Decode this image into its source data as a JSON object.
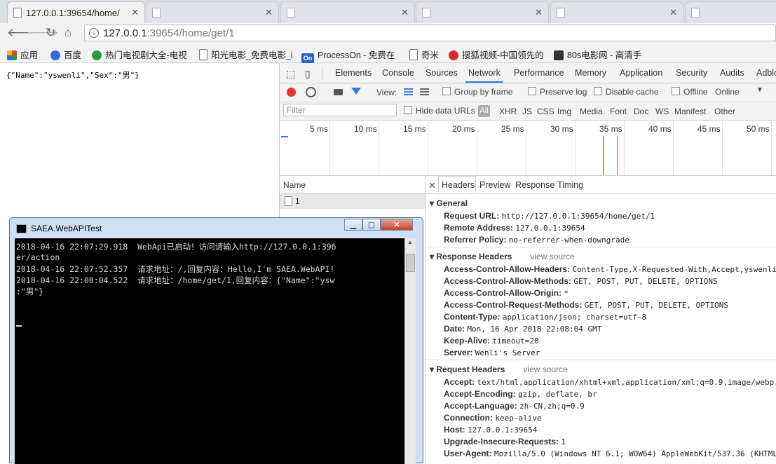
{
  "tabs": [
    {
      "title": "127.0.0.1:39654/home/",
      "state": "active"
    },
    {
      "title": "",
      "state": "inactive"
    },
    {
      "title": "",
      "state": "inactive"
    },
    {
      "title": "",
      "state": "inactive"
    },
    {
      "title": "",
      "state": "inactive"
    },
    {
      "title": "",
      "state": "inactive"
    }
  ],
  "address": {
    "host": "127.0.0.1",
    "path": ":39654/home/get/1"
  },
  "bookmarks": [
    {
      "label": "应用",
      "color": "#e0443a"
    },
    {
      "label": "百度",
      "color": "#3b68d8"
    },
    {
      "label": "热门电视剧大全-电视",
      "color": "#2a9a3c"
    },
    {
      "label": "阳光电影_免费电影_i",
      "color": "#ffffff"
    },
    {
      "label": "ProcessOn - 免费在",
      "color": "#2766c6"
    },
    {
      "label": "奇米",
      "color": "#ffffff"
    },
    {
      "label": "搜狐视频-中国领先的",
      "color": "#d62b2b"
    },
    {
      "label": "80s电影网 - 高清手",
      "color": "#333333"
    }
  ],
  "page_json_text": "{\"Name\":\"yswenli\",\"Sex\":\"男\"}",
  "devtools": {
    "tabs": [
      "Elements",
      "Console",
      "Sources",
      "Network",
      "Performance",
      "Memory",
      "Application",
      "Security",
      "Audits",
      "Adblo"
    ],
    "selected_tab": "Network",
    "controls": {
      "view_label": "View:",
      "group_by_frame": "Group by frame",
      "preserve_log": "Preserve log",
      "disable_cache": "Disable cache",
      "offline": "Offline",
      "throttle": "Online"
    },
    "filter": {
      "placeholder": "Filter",
      "hide_data_urls": "Hide data URLs",
      "all": "All",
      "types": [
        "XHR",
        "JS",
        "CSS",
        "Img",
        "Media",
        "Font",
        "Doc",
        "WS",
        "Manifest",
        "Other"
      ]
    },
    "timeline_ticks": [
      "5 ms",
      "10 ms",
      "15 ms",
      "20 ms",
      "25 ms",
      "30 ms",
      "35 ms",
      "40 ms",
      "45 ms",
      "50 ms"
    ],
    "name_header": "Name",
    "requests": [
      "1"
    ],
    "detail_tabs": [
      "Headers",
      "Preview",
      "Response",
      "Timing"
    ],
    "general": {
      "title": "General",
      "rows": [
        {
          "k": "Request URL:",
          "v": "http://127.0.0.1:39654/home/get/1"
        },
        {
          "k": "Remote Address:",
          "v": "127.0.0.1:39654"
        },
        {
          "k": "Referrer Policy:",
          "v": "no-referrer-when-downgrade"
        }
      ]
    },
    "response_headers": {
      "title": "Response Headers",
      "view_source": "view source",
      "rows": [
        {
          "k": "Access-Control-Allow-Headers:",
          "v": "Content-Type,X-Requested-With,Accept,yswenli"
        },
        {
          "k": "Access-Control-Allow-Methods:",
          "v": "GET, POST, PUT, DELETE, OPTIONS"
        },
        {
          "k": "Access-Control-Allow-Origin:",
          "v": "*"
        },
        {
          "k": "Access-Control-Request-Methods:",
          "v": "GET, POST, PUT, DELETE, OPTIONS"
        },
        {
          "k": "Content-Type:",
          "v": "application/json; charset=utf-8"
        },
        {
          "k": "Date:",
          "v": "Mon, 16 Apr 2018 22:08:04 GMT"
        },
        {
          "k": "Keep-Alive:",
          "v": "timeout=20"
        },
        {
          "k": "Server:",
          "v": "Wenli's Server"
        }
      ]
    },
    "request_headers": {
      "title": "Request Headers",
      "view_source": "view source",
      "rows": [
        {
          "k": "Accept:",
          "v": "text/html,application/xhtml+xml,application/xml;q=0.9,image/webp,"
        },
        {
          "k": "Accept-Encoding:",
          "v": "gzip, deflate, br"
        },
        {
          "k": "Accept-Language:",
          "v": "zh-CN,zh;q=0.9"
        },
        {
          "k": "Connection:",
          "v": "keep-alive"
        },
        {
          "k": "Host:",
          "v": "127.0.0.1:39654"
        },
        {
          "k": "Upgrade-Insecure-Requests:",
          "v": "1"
        },
        {
          "k": "User-Agent:",
          "v": "Mozilla/5.0 (Windows NT 6.1; WOW64) AppleWebKit/537.36 (KHTML"
        }
      ]
    }
  },
  "console": {
    "title": "SAEA.WebAPITest",
    "lines": [
      "2018-04-16 22:07:29.918  WebApi已启动！访问请输入http://127.0.0.1:396",
      "er/action",
      "2018-04-16 22:07:52.357  请求地址：/,回复内容：Hello,I'm SAEA.WebAPI!",
      "2018-04-16 22:08:04.522  请求地址：/home/get/1,回复内容：{\"Name\":\"ysw",
      ":\"男\"}"
    ]
  }
}
